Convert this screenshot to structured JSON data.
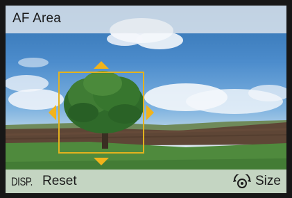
{
  "header": {
    "title": "AF Area"
  },
  "footer": {
    "disp_key": "DISP.",
    "reset_label": "Reset",
    "dial_icon": "rear-dial-icon",
    "size_label": "Size"
  },
  "af_frame": {
    "color": "#e3b21e",
    "arrow_color": "#f2b31b"
  },
  "colors": {
    "bar_background": "#e2e8ee",
    "screen_border": "#171717"
  }
}
